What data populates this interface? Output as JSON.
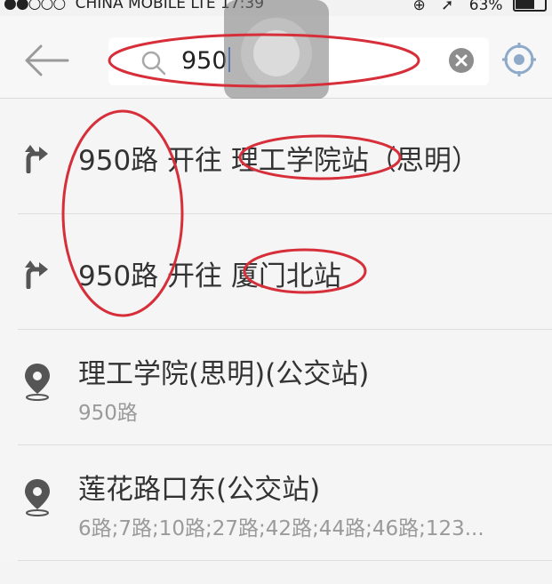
{
  "status_bar": {
    "carrier": "CHINA MOBILE",
    "network": "LTE",
    "time": "17:39",
    "battery": "63%"
  },
  "search": {
    "query": "950"
  },
  "results": [
    {
      "type": "route",
      "icon": "route-turn-icon",
      "line": "950路",
      "direction": "开往",
      "destination": "理工学院站",
      "district": "（思明）"
    },
    {
      "type": "route",
      "icon": "route-turn-icon",
      "line": "950路",
      "direction": "开往",
      "destination": "厦门北站",
      "district": ""
    },
    {
      "type": "stop",
      "icon": "location-pin-icon",
      "name": "理工学院(思明)(公交站)",
      "lines": "950路"
    },
    {
      "type": "stop",
      "icon": "location-pin-icon",
      "name": "莲花路口东(公交站)",
      "lines": "6路;7路;10路;27路;42路;44路;46路;123..."
    }
  ],
  "colors": {
    "annotation": "#d62f3a",
    "background": "#f4f4f4",
    "divider": "#dedede",
    "caret": "#3b82f6"
  }
}
